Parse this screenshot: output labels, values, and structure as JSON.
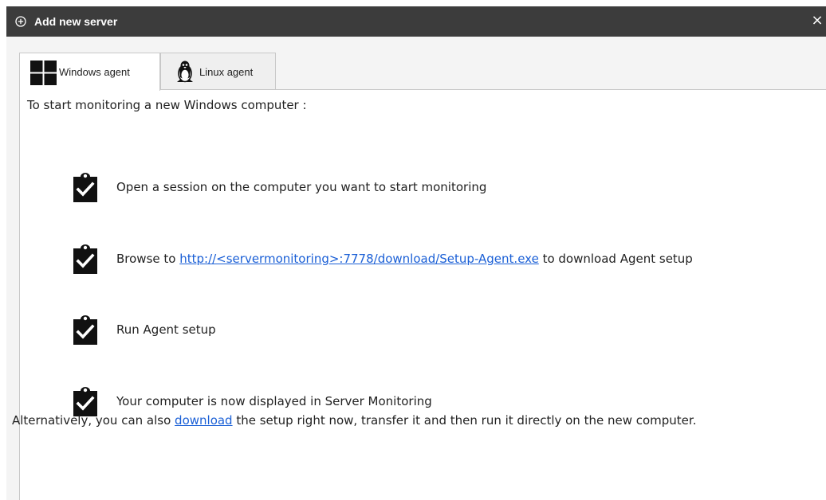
{
  "window": {
    "title": "Add new server",
    "title_icon": "plus-circle-icon",
    "close_label": "×"
  },
  "tabs": [
    {
      "label": "Windows agent",
      "icon": "windows-logo-icon",
      "active": true
    },
    {
      "label": "Linux agent",
      "icon": "linux-tux-icon",
      "active": false
    }
  ],
  "content": {
    "intro": "To start monitoring a new Windows computer :",
    "steps": [
      {
        "icon": "clipboard-check-icon",
        "text": "Open a session on the computer you want to start monitoring"
      },
      {
        "icon": "clipboard-check-icon",
        "text_before": "Browse to ",
        "link": "http://<servermonitoring>:7778/download/Setup-Agent.exe",
        "text_after": " to download Agent setup"
      },
      {
        "icon": "clipboard-check-icon",
        "text": "Run Agent setup"
      },
      {
        "icon": "clipboard-check-icon",
        "text": "Your computer is now displayed in Server Monitoring"
      }
    ],
    "alternative": {
      "before": "Alternatively, you can also ",
      "link": "download",
      "after": " the setup right now, transfer it and then run it directly on the new computer."
    }
  },
  "colors": {
    "titlebar_bg": "#3c3c3c",
    "link": "#1a5fd6",
    "panel_bg": "#f4f4f4",
    "border": "#c8c8c8"
  }
}
